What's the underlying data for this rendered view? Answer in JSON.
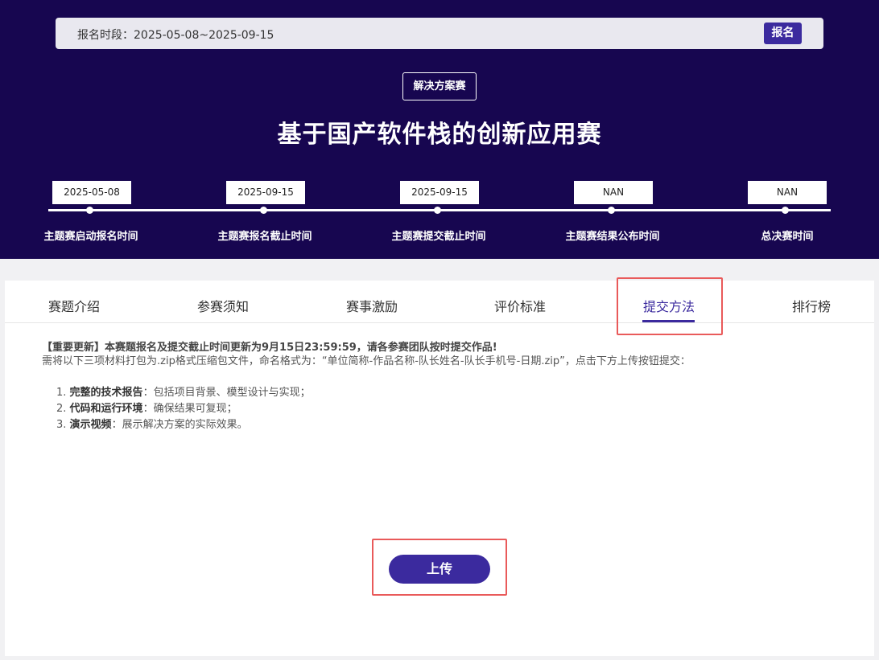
{
  "header": {
    "registration_period": "报名时段：2025-05-08~2025-09-15",
    "register_button": "报名",
    "competition_type": "解决方案赛",
    "title": "基于国产软件栈的创新应用赛"
  },
  "timeline": [
    {
      "date": "2025-05-08",
      "label": "主题赛启动报名时间"
    },
    {
      "date": "2025-09-15",
      "label": "主题赛报名截止时间"
    },
    {
      "date": "2025-09-15",
      "label": "主题赛提交截止时间"
    },
    {
      "date": "NAN",
      "label": "主题赛结果公布时间"
    },
    {
      "date": "NAN",
      "label": "总决赛时间"
    }
  ],
  "tabs": [
    {
      "label": "赛题介绍",
      "active": false
    },
    {
      "label": "参赛须知",
      "active": false
    },
    {
      "label": "赛事激励",
      "active": false
    },
    {
      "label": "评价标准",
      "active": false
    },
    {
      "label": "提交方法",
      "active": true
    },
    {
      "label": "排行榜",
      "active": false
    }
  ],
  "content": {
    "notice": "【重要更新】本赛题报名及提交截止时间更新为9月15日23:59:59，请各参赛团队按时提交作品!",
    "description": "需将以下三项材料打包为.zip格式压缩包文件，命名格式为：“单位简称-作品名称-队长姓名-队长手机号-日期.zip”，点击下方上传按钮提交：",
    "requirements": [
      {
        "num": "1.",
        "title": "完整的技术报告",
        "text": "：包括项目背景、模型设计与实现；"
      },
      {
        "num": "2.",
        "title": "代码和运行环境",
        "text": "：确保结果可复现；"
      },
      {
        "num": "3.",
        "title": "演示视频",
        "text": "：展示解决方案的实际效果。"
      }
    ],
    "upload_button": "上传"
  },
  "colors": {
    "header_bg": "#170650",
    "accent": "#3b2a9e",
    "highlight": "#e95a5a"
  }
}
